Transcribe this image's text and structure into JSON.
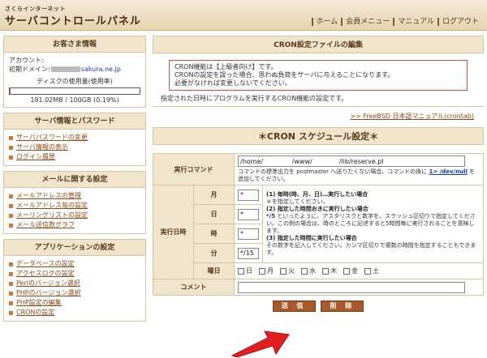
{
  "header": {
    "brand_sub": "さくらインターネット",
    "brand_main": "サーバコントロールパネル",
    "nav": [
      "ホーム",
      "会員メニュー",
      "マニュアル",
      "ログアウト"
    ]
  },
  "sidebar": {
    "customer": {
      "title": "お客さま情報",
      "account_label": "アカウント:",
      "domain_label": "初期ドメイン:",
      "domain_suffix": "sakura.ne.jp",
      "usage_title": "ディスクの使用量(使用率)",
      "usage_text": "191.02MB / 100GB (0.19%)",
      "usage_fraction": 0.0019
    },
    "server": {
      "title": "サーバ情報とパスワード",
      "items": [
        "サーバパスワードの変更",
        "サーバ情報の表示",
        "ログイン履歴"
      ]
    },
    "mail": {
      "title": "メールに関する設定",
      "items": [
        "メールアドレスの管理",
        "メールアドレス毎の設定",
        "メーリングリストの設定",
        "メール送信数グラフ"
      ]
    },
    "app": {
      "title": "アプリケーションの設定",
      "items": [
        "データベースの設定",
        "アクセスログの設定",
        "Perlのバージョン選択",
        "PHPのバージョン選択",
        "PHP設定の編集",
        "CRONの設定"
      ]
    }
  },
  "main": {
    "section_title": "CRON設定ファイルの編集",
    "warning": [
      "CRON機能は【上級者向け】です。",
      "CRONの設定を誤った場合、思わぬ負荷をサーバに与えることになります。",
      "必要がなければ変更しないでください。"
    ],
    "desc": "指定された日時にプログラムを実行するCRON機能の設定です。",
    "manual_link": ">> FreeBSD 日本語マニュアル(crontab)",
    "schedule_title": "＊CRON スケジュール設定＊",
    "command_label": "実行コマンド",
    "command_value": "/home/              /www/             /lib/reserve.pl",
    "command_note": "コマンドの標準出力を postmaster へ送りたくない場合、コマンドの後に",
    "command_note_code": "1> /dev/null",
    "command_note_end": "を追加してください。",
    "datetime_label": "実行日時",
    "month_label": "月",
    "day_label": "日",
    "hour_label": "時",
    "minute_label": "分",
    "weekday_label": "曜日",
    "month_value": "*",
    "day_value": "*",
    "hour_value": "*",
    "minute_value": "*/15",
    "notes": {
      "n1_title": "(1) 毎時(時、月、日)…実行したい場合",
      "n1_body": "＊を指定してください。",
      "n2_title": "(2) 指定した時間おきに実行したい場合",
      "n2_code": "*/5",
      "n2_body": "といったように、アスタリスクと数字を、スラッシュ区切りで指定してください。この例の場合は、時のところに記述すると5時間毎に実行されることを意味します。",
      "n3_title": "(3) 指定した時間に実行したい場合",
      "n3_body": "その数字を記入してください。カンマ区切りで複数の時間を指定することもできます。"
    },
    "weekdays": [
      "日",
      "月",
      "火",
      "水",
      "木",
      "金",
      "土"
    ],
    "comment_label": "コメント",
    "send_button": "送 信",
    "delete_button": "削 除"
  }
}
